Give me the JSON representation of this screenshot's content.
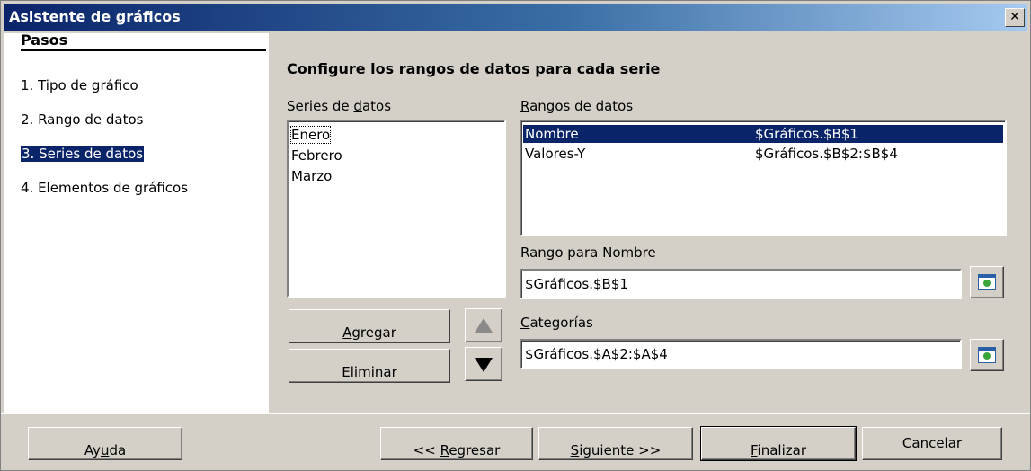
{
  "window": {
    "title": "Asistente de gráficos",
    "close_glyph": "✕"
  },
  "steps": {
    "title": "Pasos",
    "items": [
      {
        "label": "1. Tipo de gráfico"
      },
      {
        "label": "2. Rango de datos"
      },
      {
        "label": "3. Series de datos",
        "selected": true
      },
      {
        "label": "4. Elementos de gráficos"
      }
    ]
  },
  "main": {
    "heading": "Configure los rangos de datos para cada serie",
    "series_label_pre": "Series de ",
    "series_label_u": "d",
    "series_label_post": "atos",
    "series": [
      "Enero",
      "Febrero",
      "Marzo"
    ],
    "ranges_label_u": "R",
    "ranges_label_post": "angos de datos",
    "ranges": [
      {
        "role": "Nombre",
        "range": "$Gráficos.$B$1"
      },
      {
        "role": "Valores-Y",
        "range": "$Gráficos.$B$2:$B$4"
      }
    ],
    "name_range_label_pre": "Ran",
    "name_range_label_u": "g",
    "name_range_label_post": "o para Nombre",
    "name_range_value": "$Gráficos.$B$1",
    "categories_label_u": "C",
    "categories_label_post": "ategorías",
    "categories_value": "$Gráficos.$A$2:$A$4",
    "add_u": "A",
    "add_post": "gregar",
    "remove_u": "E",
    "remove_post": "liminar"
  },
  "footer": {
    "help_pre": "Ay",
    "help_u": "u",
    "help_post": "da",
    "back_pre": "<< ",
    "back_u": "R",
    "back_post": "egresar",
    "next_u": "S",
    "next_post": "iguiente >>",
    "finish_u": "F",
    "finish_post": "inalizar",
    "cancel": "Cancelar"
  }
}
